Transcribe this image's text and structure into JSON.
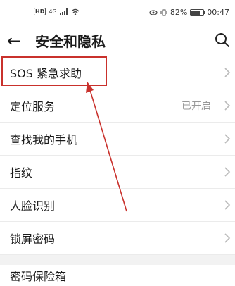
{
  "status_bar": {
    "hd": "HD",
    "signal": "4G",
    "battery_percent": "82%",
    "time": "00:47"
  },
  "header": {
    "title": "安全和隐私"
  },
  "list": {
    "items": [
      {
        "label": "SOS 紧急求助",
        "value": ""
      },
      {
        "label": "定位服务",
        "value": "已开启"
      },
      {
        "label": "查找我的手机",
        "value": ""
      },
      {
        "label": "指纹",
        "value": ""
      },
      {
        "label": "人脸识别",
        "value": ""
      },
      {
        "label": "锁屏密码",
        "value": ""
      }
    ],
    "after_gap": {
      "label": "密码保险箱"
    }
  },
  "annotation": {
    "highlight_color": "#c9312c"
  }
}
